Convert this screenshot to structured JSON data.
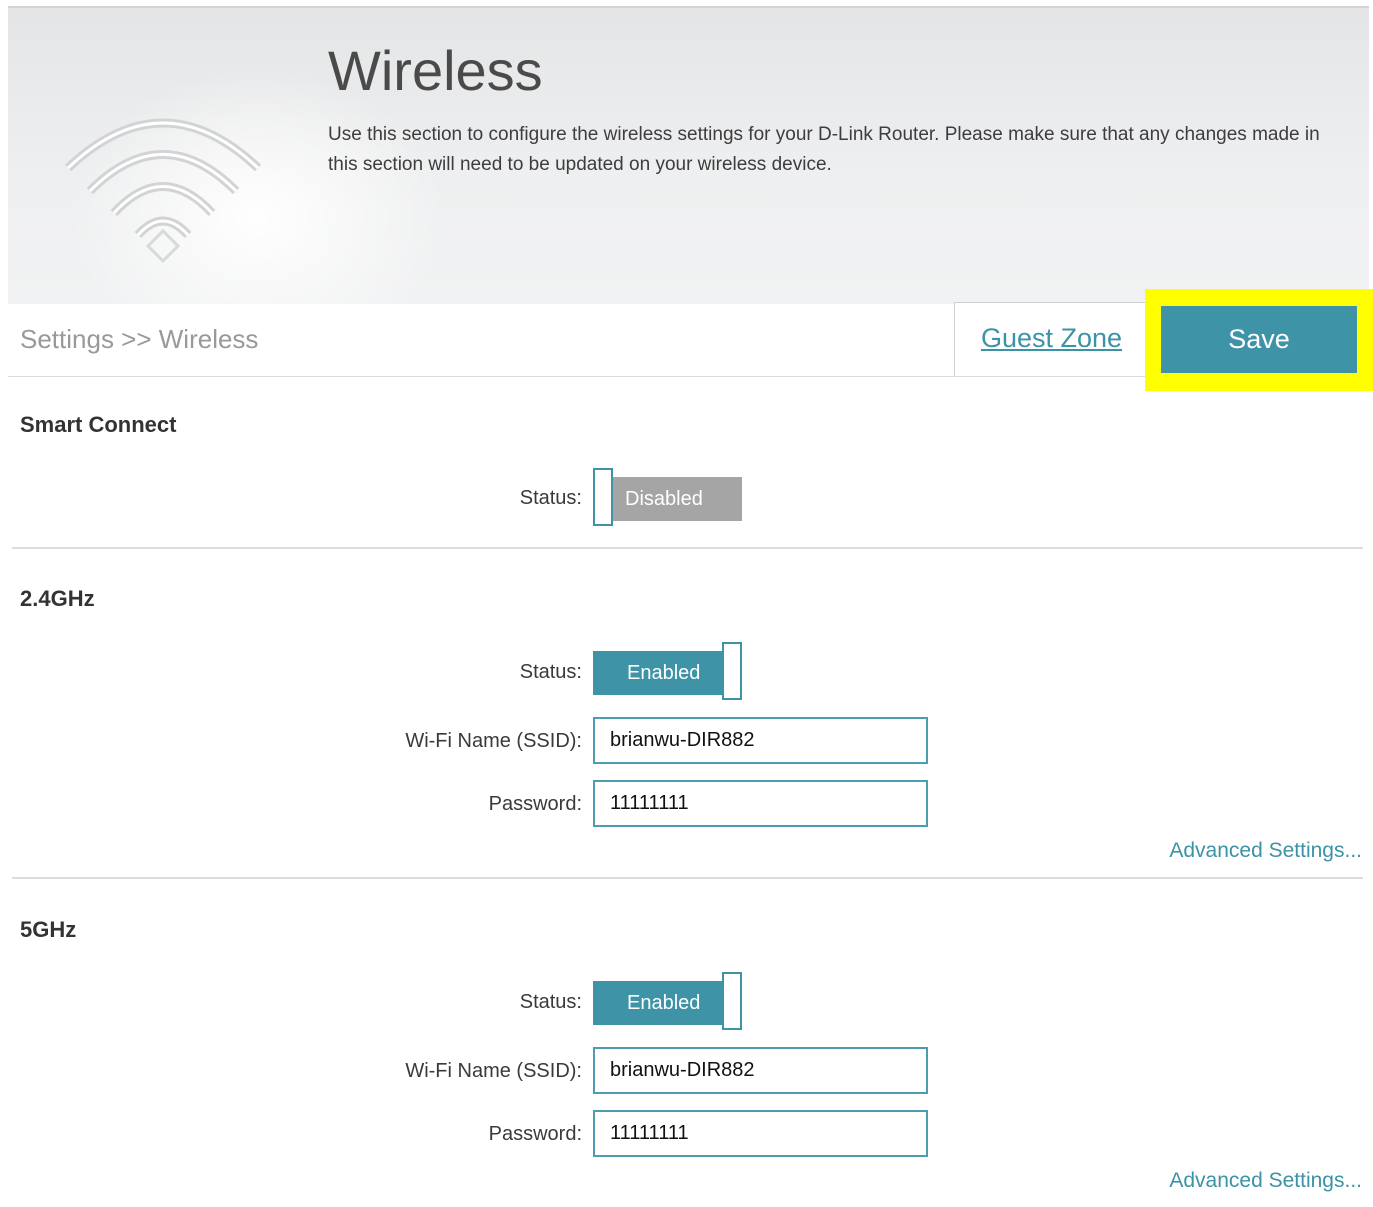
{
  "header": {
    "title": "Wireless",
    "description": "Use this section to configure the wireless settings for your D-Link Router. Please make sure that any changes made in this section will need to be updated on your wireless device.",
    "icon": "wifi-icon"
  },
  "nav": {
    "breadcrumb": "Settings >> Wireless",
    "guest_zone_label": "Guest Zone",
    "save_label": "Save"
  },
  "smart_connect": {
    "title": "Smart Connect",
    "status_label": "Status:",
    "status_value": "Disabled",
    "enabled": false
  },
  "band_24": {
    "title": "2.4GHz",
    "status_label": "Status:",
    "status_value": "Enabled",
    "enabled": true,
    "ssid_label": "Wi-Fi Name (SSID):",
    "ssid_value": "brianwu-DIR882",
    "password_label": "Password:",
    "password_value": "11111111",
    "advanced_label": "Advanced Settings..."
  },
  "band_5": {
    "title": "5GHz",
    "status_label": "Status:",
    "status_value": "Enabled",
    "enabled": true,
    "ssid_label": "Wi-Fi Name (SSID):",
    "ssid_value": "brianwu-DIR882",
    "password_label": "Password:",
    "password_value": "11111111",
    "advanced_label": "Advanced Settings..."
  },
  "colors": {
    "accent": "#3f93a7",
    "highlight": "#ffff00",
    "disabled_toggle": "#a5a5a5"
  }
}
